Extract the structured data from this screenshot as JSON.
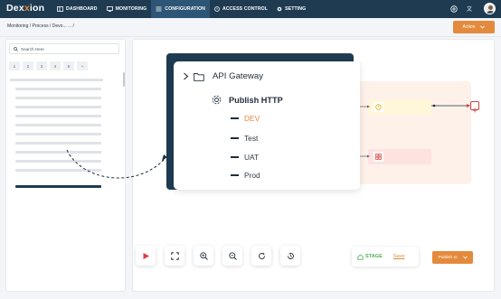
{
  "app": {
    "logo_prefix": "Dex",
    "logo_mid": "x",
    "logo_suffix": "ion"
  },
  "nav": [
    {
      "label": "DASHBOARD",
      "icon": "dashboard-icon"
    },
    {
      "label": "MONITORING",
      "icon": "monitor-icon"
    },
    {
      "label": "CONFIGURATION",
      "icon": "config-icon",
      "active": true
    },
    {
      "label": "ACCESS CONTROL",
      "icon": "access-icon"
    },
    {
      "label": "SETTING",
      "icon": "gear-icon"
    }
  ],
  "breadcrumb": "Monitoring / Process / Devo... ... /",
  "action_label": "Action",
  "search": {
    "placeholder": "Search Here"
  },
  "pager": [
    "1",
    "2",
    "3",
    "4",
    "5",
    "+"
  ],
  "card": {
    "api_label": "API Gateway",
    "publish_label": "Publish HTTP",
    "envs": [
      "DEV",
      "Test",
      "UAT",
      "Prod"
    ],
    "active_env": "DEV"
  },
  "bottom": {
    "stage_label": "STAGE",
    "save_label": "Save",
    "publish_label": "Publish to"
  },
  "colors": {
    "header": "#1e3b52",
    "accent": "#e48a3c",
    "stage": "#4caf50"
  }
}
